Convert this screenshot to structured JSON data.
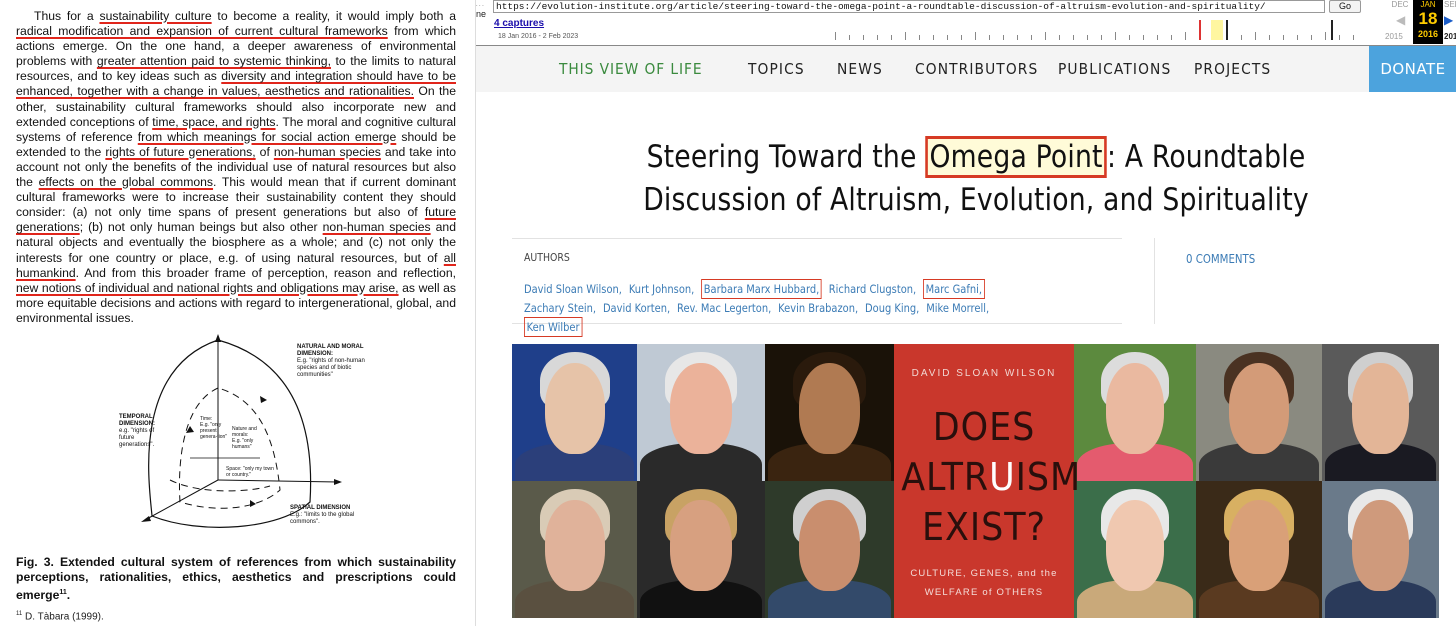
{
  "paper": {
    "body_text_segments": [
      {
        "t": "Thus for a ",
        "u": false
      },
      {
        "t": "sustainability culture",
        "u": true
      },
      {
        "t": " to become a reality, it would imply both a ",
        "u": false
      },
      {
        "t": "radical modification and expansion of current cultural frameworks",
        "u": true
      },
      {
        "t": " from which actions emerge. On the one hand, a deeper awareness of environmental problems with ",
        "u": false
      },
      {
        "t": "greater attention paid to systemic thinking,",
        "u": true
      },
      {
        "t": " to the limits to natural resources, and to key ideas such as ",
        "u": false
      },
      {
        "t": "diversity and integration should have to be enhanced, together with a change in values, aesthetics and rationalities.",
        "u": true
      },
      {
        "t": " On the other, sustainability cultural frameworks should also incorporate new and extended conceptions of ",
        "u": false
      },
      {
        "t": "time, space, and rights",
        "u": true
      },
      {
        "t": ". The moral and cognitive cultural systems of reference ",
        "u": false
      },
      {
        "t": "from which meanings for social action emerge",
        "u": true
      },
      {
        "t": " should be extended to the ",
        "u": false
      },
      {
        "t": "rights of future generations,",
        "u": true
      },
      {
        "t": " of ",
        "u": false
      },
      {
        "t": "non-human species",
        "u": true
      },
      {
        "t": " and take into account not only the benefits of the individual use of natural resources but also the ",
        "u": false
      },
      {
        "t": "effects on the global commons",
        "u": true
      },
      {
        "t": ". This would mean that if current dominant cultural frameworks were to increase their sustainability content they should consider: (a) not only time spans of present generations but also of ",
        "u": false
      },
      {
        "t": "future generations",
        "u": true
      },
      {
        "t": "; (b) not only human beings but also other ",
        "u": false
      },
      {
        "t": "non-human species",
        "u": true
      },
      {
        "t": " and natural objects and eventually the biosphere as a whole; and (c) not only the interests for one country or place, e.g. of using natural resources, but of ",
        "u": false
      },
      {
        "t": "all humankind",
        "u": true
      },
      {
        "t": ". And from this broader frame of perception, reason and reflection, ",
        "u": false
      },
      {
        "t": "new notions of individual and national rights and obligations may arise,",
        "u": true
      },
      {
        "t": " as well as more equitable decisions and actions with regard to intergenerational, global, and environmental issues.",
        "u": false
      }
    ],
    "figure": {
      "natural_moral_title": "NATURAL AND MORAL DIMENSION:",
      "natural_moral_text": "E.g. \"rights of non-human species and of biotic communities\"",
      "temporal_title": "TEMPORAL DIMENSION:",
      "temporal_text": "e.g. \"rights of future generations\".",
      "spatial_title": "SPATIAL DIMENSION",
      "spatial_text": "E.g.: \"limits to the global commons\".",
      "time_label": "Time:",
      "time_text": "E.g. \"only present genera-tion\"",
      "nature_label": "Nature and morals:",
      "nature_text": "E.g. \"only humans\"",
      "space_label": "Space:",
      "space_text": "\"only my town or country.\""
    },
    "caption": "Fig. 3. Extended cultural system of references from which sustainability perceptions, rationalities, ethics, aesthetics and prescriptions could emerge",
    "caption_sup": "11",
    "caption_end": ".",
    "footnote_num": "11",
    "footnote": " D. Tàbara (1999)."
  },
  "browser": {
    "url": "https://evolution-institute.org/article/steering-toward-the-omega-point-a-roundtable-discussion-of-altruism-evolution-and-spirituality/",
    "go_label": "Go",
    "captures": "4 captures",
    "capture_range": "18 Jan 2016 - 2 Feb 2023",
    "prev_month": "DEC",
    "cur_month": "JAN",
    "cur_day": "18",
    "cur_year": "2016",
    "next_month": "SEP",
    "prev_year": "2015",
    "next_year": "201",
    "logo_letters": "ne"
  },
  "site": {
    "brand": "THIS VIEW OF LIFE",
    "nav": [
      "TOPICS",
      "NEWS",
      "CONTRIBUTORS",
      "PUBLICATIONS",
      "PROJECTS"
    ],
    "donate": "DONATE",
    "title_before": "Steering Toward the ",
    "title_highlight": "Omega Point",
    "title_after": ": A Roundtable Discussion of Altruism, Evolution, and Spirituality",
    "authors_label": "AUTHORS",
    "comments": "0 COMMENTS",
    "authors": [
      {
        "name": "David Sloan Wilson,",
        "boxed": false
      },
      {
        "name": "Kurt Johnson,",
        "boxed": false
      },
      {
        "name": "Barbara Marx Hubbard,",
        "boxed": true
      },
      {
        "name": "Richard Clugston,",
        "boxed": false
      },
      {
        "name": "Marc Gafni,",
        "boxed": true
      },
      {
        "name": "Zachary Stein,",
        "boxed": false
      },
      {
        "name": "David Korten,",
        "boxed": false
      },
      {
        "name": "Rev. Mac Legerton,",
        "boxed": false
      },
      {
        "name": "Kevin Brabazon,",
        "boxed": false
      },
      {
        "name": "Doug King,",
        "boxed": false
      },
      {
        "name": "Mike Morrell,",
        "boxed": false
      },
      {
        "name": "Ken Wilber",
        "boxed": true
      }
    ],
    "book": {
      "author": "DAVID SLOAN WILSON",
      "line1": "DOES",
      "line2a": "ALTR",
      "line2b": "U",
      "line2c": "ISM",
      "line3": "EXIST?",
      "sub1": "CULTURE, GENES, and the",
      "sub2": "WELFARE of OTHERS"
    }
  }
}
